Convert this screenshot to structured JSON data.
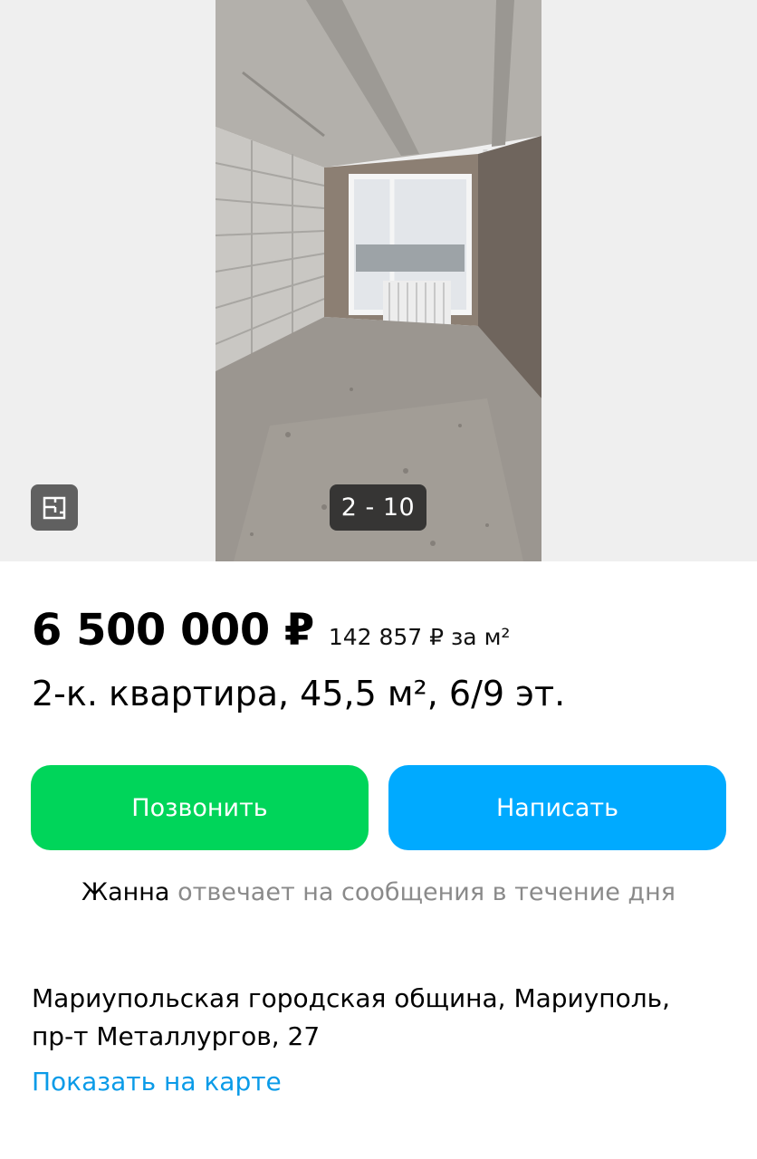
{
  "gallery": {
    "counter": "2 - 10",
    "floorplan_icon": "floorplan-icon"
  },
  "listing": {
    "price": "6 500 000 ₽",
    "price_per_m2": "142 857 ₽ за м²",
    "title": "2-к. квартира, 45,5 м², 6/9 эт."
  },
  "actions": {
    "call_label": "Позвонить",
    "write_label": "Написать",
    "call_color": "#00d55a",
    "write_color": "#00aaff"
  },
  "seller": {
    "name": "Жанна",
    "response_text": " отвечает на сообщения в течение дня"
  },
  "location": {
    "address_line1": "Мариупольская городская община, Мариуполь,",
    "address_line2": "пр-т Металлургов, 27",
    "map_link": "Показать на карте",
    "link_color": "#0a9be8"
  }
}
